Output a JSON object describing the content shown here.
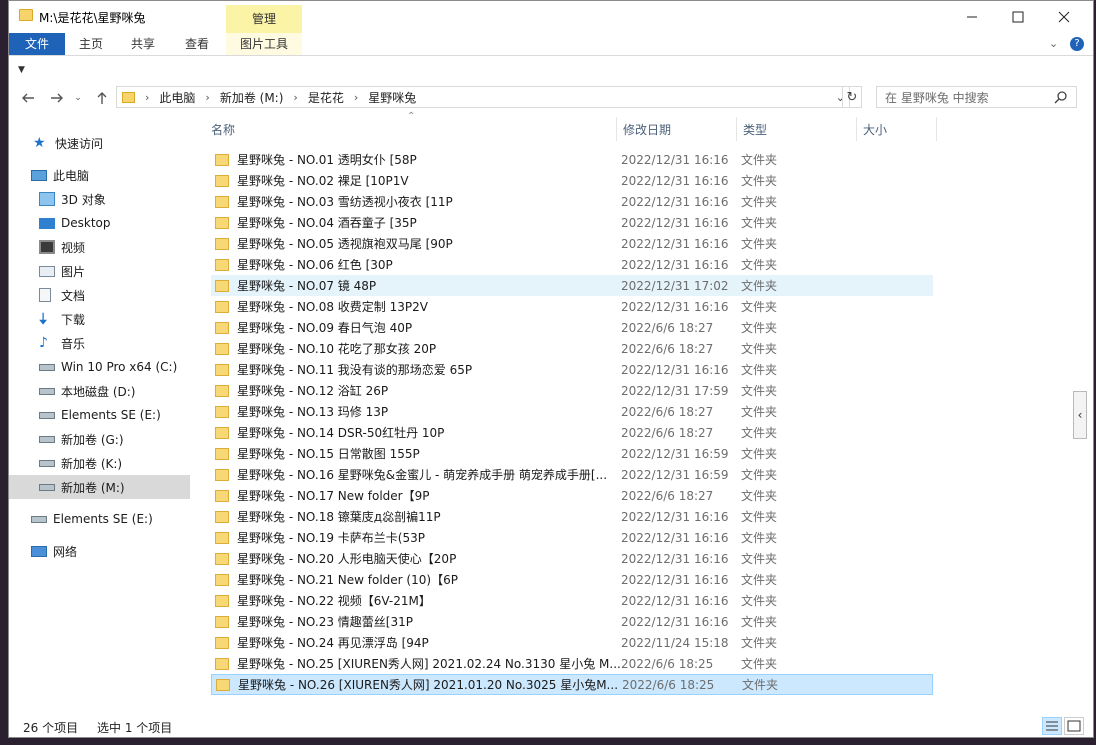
{
  "window": {
    "title": "M:\\是花花\\星野咪兔",
    "manage_tab": "管理",
    "min_icon": "minimize-icon",
    "max_icon": "maximize-icon",
    "close_icon": "close-icon"
  },
  "ribbon": {
    "tabs": [
      "文件",
      "主页",
      "共享",
      "查看",
      "图片工具"
    ],
    "accent": "#1e63b8"
  },
  "address": {
    "crumbs": [
      "此电脑",
      "新加卷 (M:)",
      "是花花",
      "星野咪兔"
    ],
    "search_placeholder": "在 星野咪兔 中搜索"
  },
  "sidebar": {
    "items": [
      {
        "label": "快速访问",
        "icon": "star-icon"
      },
      {
        "label": "此电脑",
        "icon": "computer-icon"
      },
      {
        "label": "3D 对象",
        "icon": "cube-icon"
      },
      {
        "label": "Desktop",
        "icon": "desktop-icon"
      },
      {
        "label": "视频",
        "icon": "video-icon"
      },
      {
        "label": "图片",
        "icon": "picture-icon"
      },
      {
        "label": "文档",
        "icon": "document-icon"
      },
      {
        "label": "下载",
        "icon": "download-icon"
      },
      {
        "label": "音乐",
        "icon": "music-icon"
      },
      {
        "label": "Win 10 Pro x64 (C:)",
        "icon": "drive-icon"
      },
      {
        "label": "本地磁盘 (D:)",
        "icon": "drive-icon"
      },
      {
        "label": "Elements SE (E:)",
        "icon": "drive-icon"
      },
      {
        "label": "新加卷 (G:)",
        "icon": "drive-icon"
      },
      {
        "label": "新加卷 (K:)",
        "icon": "drive-icon"
      },
      {
        "label": "新加卷 (M:)",
        "icon": "drive-icon"
      },
      {
        "label": "Elements SE (E:)",
        "icon": "drive-icon"
      },
      {
        "label": "网络",
        "icon": "network-icon"
      }
    ]
  },
  "columns": [
    "名称",
    "修改日期",
    "类型",
    "大小"
  ],
  "files": [
    {
      "name": "星野咪兔 - NO.01 透明女仆 [58P",
      "date": "2022/12/31 16:16",
      "type": "文件夹"
    },
    {
      "name": "星野咪兔 - NO.02 裸足 [10P1V",
      "date": "2022/12/31 16:16",
      "type": "文件夹"
    },
    {
      "name": "星野咪兔 - NO.03 雪纺透视小夜衣 [11P",
      "date": "2022/12/31 16:16",
      "type": "文件夹"
    },
    {
      "name": "星野咪兔 - NO.04 酒吞童子 [35P",
      "date": "2022/12/31 16:16",
      "type": "文件夹"
    },
    {
      "name": "星野咪兔 - NO.05 透视旗袍双马尾 [90P",
      "date": "2022/12/31 16:16",
      "type": "文件夹"
    },
    {
      "name": "星野咪兔 - NO.06 红色 [30P",
      "date": "2022/12/31 16:16",
      "type": "文件夹"
    },
    {
      "name": "星野咪兔 - NO.07 镜 48P",
      "date": "2022/12/31 17:02",
      "type": "文件夹"
    },
    {
      "name": "星野咪兔 - NO.08 收费定制 13P2V",
      "date": "2022/12/31 16:16",
      "type": "文件夹"
    },
    {
      "name": "星野咪兔 - NO.09 春日气泡 40P",
      "date": "2022/6/6 18:27",
      "type": "文件夹"
    },
    {
      "name": "星野咪兔 - NO.10 花吃了那女孩 20P",
      "date": "2022/6/6 18:27",
      "type": "文件夹"
    },
    {
      "name": "星野咪兔 - NO.11 我没有谈的那场恋爱 65P",
      "date": "2022/12/31 16:16",
      "type": "文件夹"
    },
    {
      "name": "星野咪兔 - NO.12 浴缸 26P",
      "date": "2022/12/31 17:59",
      "type": "文件夹"
    },
    {
      "name": "星野咪兔 - NO.13 玛修 13P",
      "date": "2022/6/6 18:27",
      "type": "文件夹"
    },
    {
      "name": "星野咪兔 - NO.14 DSR-50红牡丹 10P",
      "date": "2022/6/6 18:27",
      "type": "文件夹"
    },
    {
      "name": "星野咪兔 - NO.15 日常散图 155P",
      "date": "2022/12/31 16:59",
      "type": "文件夹"
    },
    {
      "name": "星野咪兔 - NO.16 星野咪兔&金蜜儿 - 萌宠养成手册 萌宠养成手册[...",
      "date": "2022/12/31 16:59",
      "type": "文件夹"
    },
    {
      "name": "星野咪兔 - NO.17 New folder【9P",
      "date": "2022/6/6 18:27",
      "type": "文件夹"
    },
    {
      "name": "星野咪兔 - NO.18 镲葉庋д惢剖褊11P",
      "date": "2022/12/31 16:16",
      "type": "文件夹"
    },
    {
      "name": "星野咪兔 - NO.19 卡萨布兰卡(53P",
      "date": "2022/12/31 16:16",
      "type": "文件夹"
    },
    {
      "name": "星野咪兔 - NO.20 人形电脑天使心【20P",
      "date": "2022/12/31 16:16",
      "type": "文件夹"
    },
    {
      "name": "星野咪兔 - NO.21 New folder (10)【6P",
      "date": "2022/12/31 16:16",
      "type": "文件夹"
    },
    {
      "name": "星野咪兔 - NO.22 视频【6V-21M】",
      "date": "2022/12/31 16:16",
      "type": "文件夹"
    },
    {
      "name": "星野咪兔 - NO.23 情趣蕾丝[31P",
      "date": "2022/12/31 16:16",
      "type": "文件夹"
    },
    {
      "name": "星野咪兔 - NO.24 再见漂浮岛 [94P",
      "date": "2022/11/24 15:18",
      "type": "文件夹"
    },
    {
      "name": "星野咪兔 - NO.25 [XIUREN秀人网] 2021.02.24 No.3130 星小兔 M...",
      "date": "2022/6/6 18:25",
      "type": "文件夹"
    },
    {
      "name": "星野咪兔 - NO.26 [XIUREN秀人网] 2021.01.20 No.3025 星小兔M...",
      "date": "2022/6/6 18:25",
      "type": "文件夹"
    }
  ],
  "status": {
    "count": "26 个项目",
    "selected": "选中 1 个项目"
  }
}
